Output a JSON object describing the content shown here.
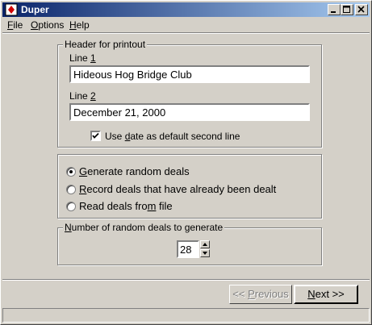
{
  "window": {
    "title": "Duper"
  },
  "menu": {
    "file": {
      "before": "",
      "key": "F",
      "after": "ile"
    },
    "options": {
      "before": "",
      "key": "O",
      "after": "ptions"
    },
    "help": {
      "before": "",
      "key": "H",
      "after": "elp"
    }
  },
  "header_group": {
    "legend": "Header for printout",
    "line1_label": {
      "before": "Line ",
      "key": "1",
      "after": ""
    },
    "line1_value": "Hideous Hog Bridge Club",
    "line2_label": {
      "before": "Line ",
      "key": "2",
      "after": ""
    },
    "line2_value": "December 21, 2000",
    "use_date": {
      "before": "Use ",
      "key": "d",
      "after": "ate as default second line",
      "checked": true
    }
  },
  "mode_group": {
    "options": [
      {
        "before": "",
        "key": "G",
        "after": "enerate random deals",
        "selected": true
      },
      {
        "before": "",
        "key": "R",
        "after": "ecord deals that have already been dealt",
        "selected": false
      },
      {
        "before": "Read deals fro",
        "key": "m",
        "after": " file",
        "selected": false
      }
    ]
  },
  "count_group": {
    "legend": {
      "before": "",
      "key": "N",
      "after": "umber of random deals to generate"
    },
    "value": "28"
  },
  "nav": {
    "previous": {
      "before": "<< ",
      "key": "P",
      "after": "revious",
      "enabled": false
    },
    "next": {
      "before": "",
      "key": "N",
      "after": "ext >>",
      "enabled": true
    }
  }
}
